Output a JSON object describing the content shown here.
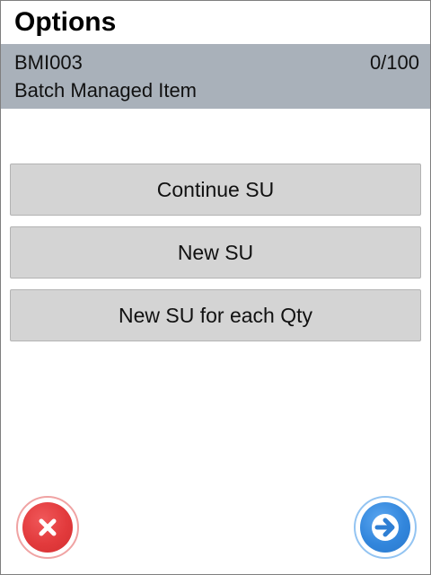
{
  "header": {
    "title": "Options"
  },
  "item": {
    "code": "BMI003",
    "quantity": "0/100",
    "description": "Batch Managed Item"
  },
  "options": [
    {
      "label": "Continue SU"
    },
    {
      "label": "New SU"
    },
    {
      "label": "New SU for each Qty"
    }
  ],
  "footer": {
    "cancel_icon": "close-x-icon",
    "next_icon": "arrow-right-icon"
  },
  "colors": {
    "info_bar": "#a9b1ba",
    "button_bg": "#d4d4d4",
    "cancel_red": "#e23a3c",
    "next_blue": "#3286dc"
  }
}
